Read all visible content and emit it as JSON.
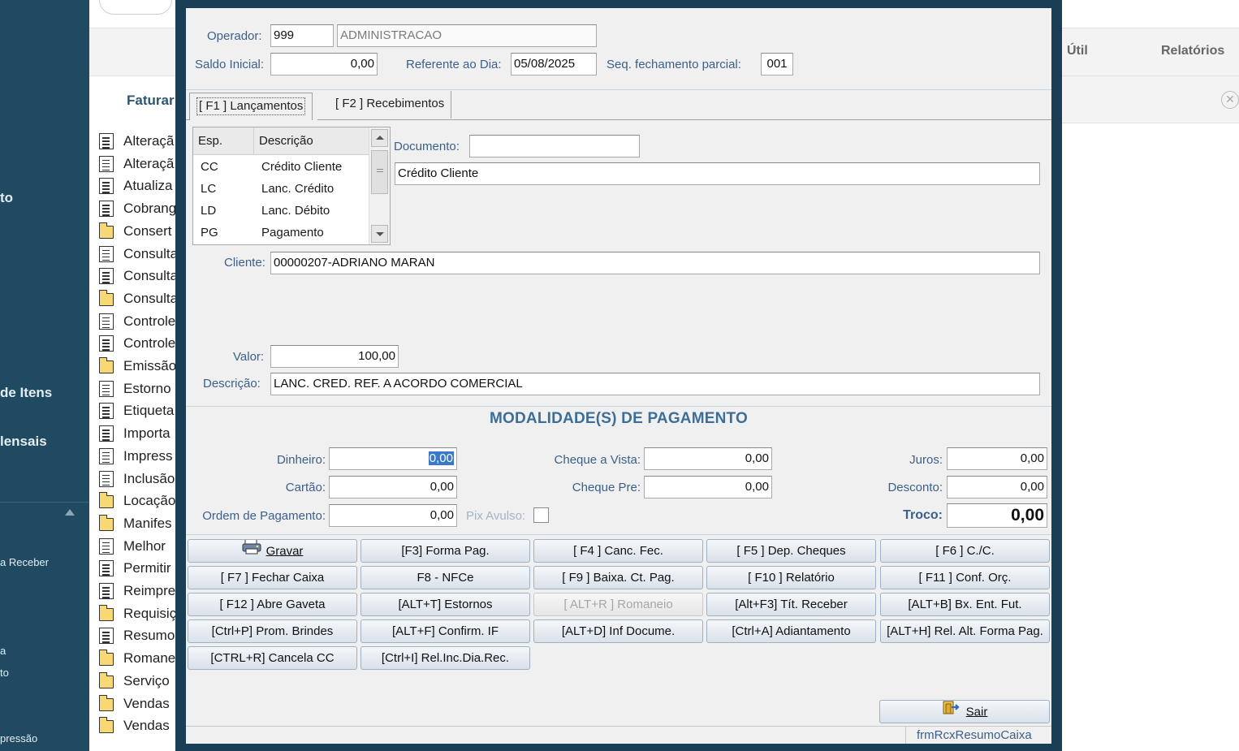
{
  "sidebar": {
    "items": [
      "to",
      "de Itens",
      "lensais"
    ],
    "sub_items": [
      "a Receber",
      "a",
      "to",
      "pressão"
    ]
  },
  "menu_list": {
    "header": "Faturar",
    "items": [
      {
        "label": "Alteraçã",
        "icon": "document-icon"
      },
      {
        "label": "Alteraçã",
        "icon": "document-icon"
      },
      {
        "label": "Atualiza",
        "icon": "document-icon"
      },
      {
        "label": "Cobrang",
        "icon": "document-icon"
      },
      {
        "label": "Consert",
        "icon": "folder-icon"
      },
      {
        "label": "Consulta",
        "icon": "document-icon"
      },
      {
        "label": "Consulta",
        "icon": "document-icon"
      },
      {
        "label": "Consulta",
        "icon": "folder-icon"
      },
      {
        "label": "Controle",
        "icon": "document-icon"
      },
      {
        "label": "Controle",
        "icon": "document-icon"
      },
      {
        "label": "Emissão",
        "icon": "folder-icon"
      },
      {
        "label": "Estorno",
        "icon": "document-icon"
      },
      {
        "label": "Etiqueta",
        "icon": "document-icon"
      },
      {
        "label": "Importa",
        "icon": "document-icon"
      },
      {
        "label": "Impress",
        "icon": "document-icon"
      },
      {
        "label": "Inclusão",
        "icon": "document-icon"
      },
      {
        "label": "Locação",
        "icon": "folder-icon"
      },
      {
        "label": "Manifes",
        "icon": "folder-icon"
      },
      {
        "label": "Melhor",
        "icon": "document-icon"
      },
      {
        "label": "Permitir",
        "icon": "document-icon"
      },
      {
        "label": "Reimpre",
        "icon": "document-icon"
      },
      {
        "label": "Requisiç",
        "icon": "folder-icon"
      },
      {
        "label": "Resumo",
        "icon": "document-icon"
      },
      {
        "label": "Romane",
        "icon": "folder-icon"
      },
      {
        "label": "Serviço",
        "icon": "folder-icon"
      },
      {
        "label": "Vendas",
        "icon": "folder-icon"
      },
      {
        "label": "Vendas",
        "icon": "folder-icon"
      }
    ]
  },
  "top_tabs": {
    "util": "Útil",
    "relatorios": "Relatórios"
  },
  "header": {
    "operador_label": "Operador:",
    "operador_code": "999",
    "operador_name": "ADMINISTRACAO",
    "saldo_label": "Saldo Inicial:",
    "saldo_value": "0,00",
    "referente_label": "Referente ao Dia:",
    "referente_value": "05/08/2025",
    "seq_label": "Seq. fechamento parcial:",
    "seq_value": "001"
  },
  "tabs": [
    {
      "label": "[ F1 ] Lançamentos",
      "active": true
    },
    {
      "label": "[ F2 ] Recebimentos",
      "active": false
    }
  ],
  "esp_list": {
    "col_esp": "Esp.",
    "col_desc": "Descrição",
    "rows": [
      {
        "esp": "CC",
        "desc": "Crédito Cliente"
      },
      {
        "esp": "LC",
        "desc": "Lanc. Crédito"
      },
      {
        "esp": "LD",
        "desc": "Lanc. Débito"
      },
      {
        "esp": "PG",
        "desc": "Pagamento"
      }
    ]
  },
  "lancamento": {
    "documento_label": "Documento:",
    "documento_value": "",
    "tipo_desc": "Crédito Cliente",
    "cliente_label": "Cliente:",
    "cliente_value": "00000207-ADRIANO MARAN",
    "valor_label": "Valor:",
    "valor_value": "100,00",
    "descricao_label": "Descrição:",
    "descricao_value": "LANC. CRED. REF. A ACORDO COMERCIAL"
  },
  "modalidades": {
    "title": "MODALIDADE(S)  DE PAGAMENTO",
    "dinheiro_label": "Dinheiro:",
    "dinheiro_value": "0,00",
    "cartao_label": "Cartão:",
    "cartao_value": "0,00",
    "ordem_label": "Ordem de Pagamento:",
    "ordem_value": "0,00",
    "pix_label": "Pix Avulso:",
    "cheque_vista_label": "Cheque a Vista:",
    "cheque_vista_value": "0,00",
    "cheque_pre_label": "Cheque Pre:",
    "cheque_pre_value": "0,00",
    "juros_label": "Juros:",
    "juros_value": "0,00",
    "desconto_label": "Desconto:",
    "desconto_value": "0,00",
    "troco_label": "Troco:",
    "troco_value": "0,00"
  },
  "buttons": {
    "gravar": "Gravar",
    "forma_pag": "[F3] Forma Pag.",
    "canc_fec": "[ F4 ] Canc. Fec.",
    "dep_cheques": "[ F5 ] Dep. Cheques",
    "cc": "[ F6 ] C./C.",
    "fechar_caixa": "[ F7 ] Fechar Caixa",
    "nfce": "F8 - NFCe",
    "baixa_ct_pag": "[ F9 ] Baixa. Ct. Pag.",
    "relatorio": "[ F10 ] Relatório",
    "conf_orc": "[ F11 ] Conf. Orç.",
    "abre_gaveta": "[ F12 ] Abre Gaveta",
    "estornos": "[ALT+T] Estornos",
    "romaneio": "[ ALT+R ] Romaneio",
    "tit_receber": "[Alt+F3] Tít. Receber",
    "bx_ent_fut": "[ALT+B] Bx. Ent. Fut.",
    "prom_brindes": "[Ctrl+P] Prom. Brindes",
    "confirm_if": "[ALT+F] Confirm. IF",
    "inf_docume": "[ALT+D] Inf Docume.",
    "adiantamento": "[Ctrl+A] Adiantamento",
    "rel_alt_forma_pag": "[ALT+H] Rel. Alt. Forma Pag.",
    "cancela_cc": "[CTRL+R] Cancela CC",
    "rel_inc_dia_rec": "[Ctrl+I] Rel.Inc.Dia.Rec.",
    "sair": "Sair"
  },
  "status": {
    "form_name": "frmRcxResumoCaixa"
  }
}
